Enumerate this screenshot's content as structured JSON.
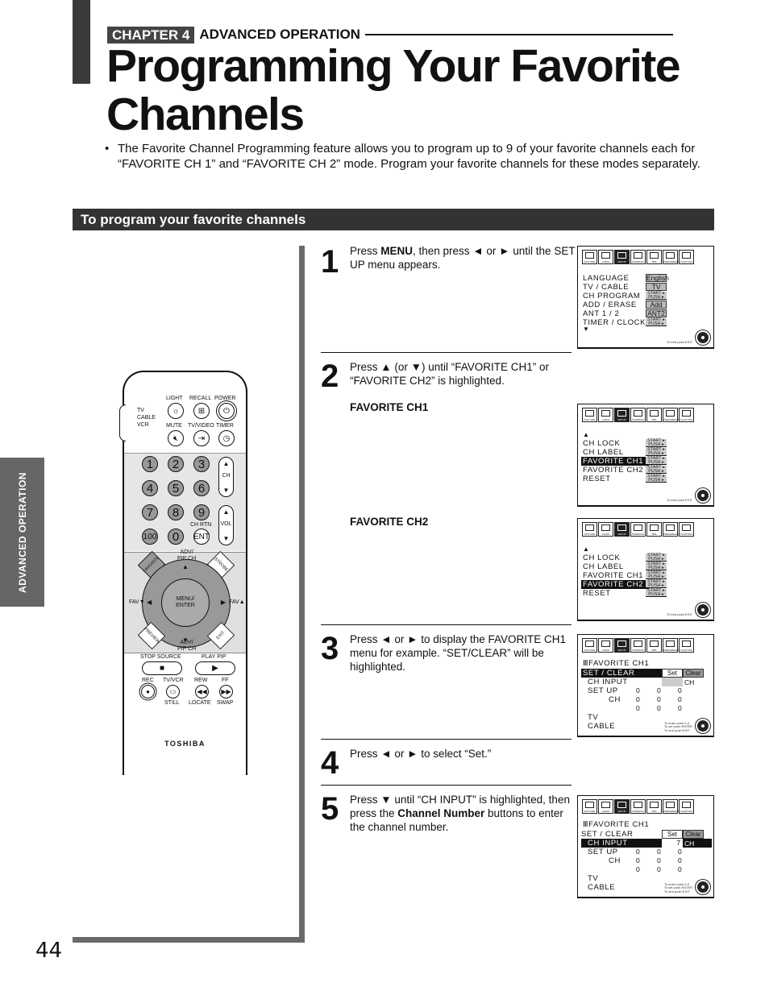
{
  "header": {
    "chapter_tag": "CHAPTER 4",
    "chapter_title": "ADVANCED OPERATION",
    "page_title_line1": "Programming Your Favorite",
    "page_title_line2": "Channels",
    "intro_bullet": "•",
    "intro_text": "The Favorite Channel Programming feature allows you to program up to 9 of your favorite channels each for “FAVORITE CH 1” and “FAVORITE CH 2” mode. Program your favorite channels for these modes separately."
  },
  "section": {
    "title": "To program your favorite channels"
  },
  "side_tab": "ADVANCED OPERATION",
  "page_number": "44",
  "steps": [
    {
      "num": "1",
      "text_pre": "Press ",
      "bold1": "MENU",
      "text_post": ", then press ◄ or ► until the SET UP menu appears."
    },
    {
      "num": "2",
      "text": "Press  ▲ (or ▼) until “FAVORITE CH1” or “FAVORITE CH2” is highlighted.",
      "sub1": "FAVORITE CH1",
      "sub2": "FAVORITE CH2"
    },
    {
      "num": "3",
      "text": "Press ◄ or ► to display the FAVORITE CH1 menu for example. “SET/CLEAR” will be highlighted."
    },
    {
      "num": "4",
      "text": "Press ◄ or ► to select “Set.”"
    },
    {
      "num": "5",
      "text_pre": "Press ▼ until “CH INPUT” is highlighted, then press the ",
      "bold1": "Channel Number",
      "text_post": " buttons to enter the channel number."
    }
  ],
  "osd": {
    "icon_labels": [
      "PICTURE",
      "AUDIO",
      "SETUP",
      "PREMIUM",
      "SBS",
      "PREFERENCE",
      "CCAPTION"
    ],
    "setup_menu": {
      "rows": [
        "LANGUAGE",
        "TV / CABLE",
        "CH  PROGRAM",
        "ADD / ERASE",
        "ANT 1 / 2",
        "TIMER / CLOCK"
      ],
      "values": [
        "English",
        "TV",
        "START PUSH",
        "Add",
        "ANT2",
        "START PUSH"
      ],
      "more_arrow": "▼",
      "footer": "To end push EXIT"
    },
    "fav_menu": {
      "up_arrow": "▲",
      "rows": [
        "CH  LOCK",
        "CH  LABEL",
        "FAVORITE  CH1",
        "FAVORITE  CH2",
        "RESET"
      ],
      "start_label": "START",
      "push_label": "PUSH",
      "footer": "To end push EXIT"
    },
    "fav_ch1_menu": {
      "title": "FAVORITE  CH1",
      "set_clear": "SET / CLEAR",
      "set": "Set",
      "clear": "Clear",
      "ch_input": "CH  INPUT",
      "ch_suffix": "CH",
      "set_up": "SET  UP",
      "ch": "CH",
      "grid": [
        [
          "0",
          "0",
          "0"
        ],
        [
          "0",
          "0",
          "0"
        ],
        [
          "0",
          "0",
          "0"
        ]
      ],
      "tv": "TV",
      "cable": "CABLE",
      "footer_lines": [
        "To enter push 0-9",
        "To set push ENTER",
        "To end push EXIT"
      ],
      "input_value_step5": "7"
    }
  },
  "remote": {
    "switch_labels": [
      "TV",
      "CABLE",
      "VCR"
    ],
    "top_labels": [
      "LIGHT",
      "RECALL",
      "POWER"
    ],
    "top_labels2": [
      "MUTE",
      "TV/VIDEO",
      "TIMER"
    ],
    "numbers": [
      "1",
      "2",
      "3",
      "4",
      "5",
      "6",
      "7",
      "8",
      "9",
      "100",
      "0",
      "ENT"
    ],
    "ch_rtn": "CH RTN",
    "ch": "CH",
    "vol": "VOL",
    "adv_pip": "ADV/\nPIP CH",
    "favorite": "FAVORITE",
    "strobe": "STROBE",
    "preview": "PREVIEW",
    "exit": "EXIT",
    "menu_enter": "MENU/\nENTER",
    "fav_down": "FAV▼",
    "fav_up": "FAV▲",
    "stop_source": "STOP SOURCE",
    "play_pip": "PLAY PIP",
    "rec": "REC",
    "tvvcr": "TV/VCR",
    "rew": "REW",
    "ff": "FF",
    "still": "STILL",
    "locate": "LOCATE",
    "swap": "SWAP",
    "brand": "TOSHIBA"
  }
}
